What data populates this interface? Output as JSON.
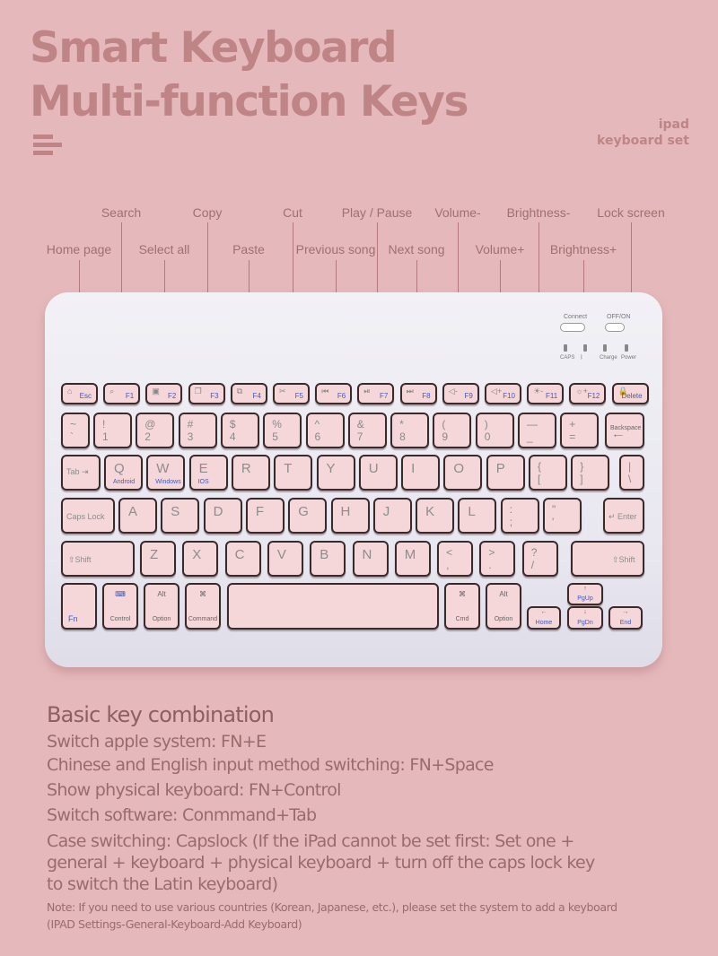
{
  "header": {
    "title_line1": "Smart Keyboard",
    "title_line2": "Multi-function Keys",
    "subtitle_line1": "ipad",
    "subtitle_line2": "keyboard set"
  },
  "callouts": {
    "row1": [
      "Search",
      "Copy",
      "Cut",
      "Play / Pause",
      "Volume-",
      "Brightness-",
      "Lock screen"
    ],
    "row2": [
      "Home page",
      "Select all",
      "Paste",
      "Previous song",
      "Next song",
      "Volume+",
      "Brightness+"
    ]
  },
  "keyboard": {
    "switches": {
      "connect": "Connect",
      "power": "OFF/ON"
    },
    "indicators": [
      "CAPS",
      "ᛒ",
      "Charge",
      "Power"
    ],
    "fn_row": [
      {
        "icon": "⌂",
        "label": "Esc"
      },
      {
        "icon": "⌕",
        "label": "F1"
      },
      {
        "icon": "▣",
        "label": "F2"
      },
      {
        "icon": "❐",
        "label": "F3"
      },
      {
        "icon": "⧉",
        "label": "F4"
      },
      {
        "icon": "✂",
        "label": "F5"
      },
      {
        "icon": "⏮",
        "label": "F6"
      },
      {
        "icon": "⏯",
        "label": "F7"
      },
      {
        "icon": "⏭",
        "label": "F8"
      },
      {
        "icon": "◁-",
        "label": "F9"
      },
      {
        "icon": "◁+",
        "label": "F10"
      },
      {
        "icon": "☀-",
        "label": "F11"
      },
      {
        "icon": "☼+",
        "label": "F12"
      },
      {
        "icon": "🔒",
        "label": "Delete"
      }
    ],
    "number_row": [
      {
        "top": "~",
        "bot": "`"
      },
      {
        "top": "!",
        "bot": "1"
      },
      {
        "top": "@",
        "bot": "2"
      },
      {
        "top": "#",
        "bot": "3"
      },
      {
        "top": "$",
        "bot": "4"
      },
      {
        "top": "%",
        "bot": "5"
      },
      {
        "top": "^",
        "bot": "6"
      },
      {
        "top": "&",
        "bot": "7"
      },
      {
        "top": "*",
        "bot": "8"
      },
      {
        "top": "(",
        "bot": "9"
      },
      {
        "top": ")",
        "bot": "0"
      },
      {
        "top": "—",
        "bot": "_"
      },
      {
        "top": "+",
        "bot": "="
      },
      {
        "top": "Backspace",
        "bot": "⟵"
      }
    ],
    "qwerty_row": [
      {
        "main": "Tab ⇥"
      },
      {
        "main": "Q",
        "sub": "Android"
      },
      {
        "main": "W",
        "sub": "Windows"
      },
      {
        "main": "E",
        "sub": "IOS"
      },
      {
        "main": "R"
      },
      {
        "main": "T"
      },
      {
        "main": "Y"
      },
      {
        "main": "U"
      },
      {
        "main": "I"
      },
      {
        "main": "O"
      },
      {
        "main": "P"
      },
      {
        "top": "{",
        "bot": "["
      },
      {
        "top": "}",
        "bot": "]"
      },
      {
        "top": "|",
        "bot": "\\"
      }
    ],
    "home_row": [
      {
        "main": "Caps Lock"
      },
      {
        "main": "A"
      },
      {
        "main": "S"
      },
      {
        "main": "D"
      },
      {
        "main": "F"
      },
      {
        "main": "G"
      },
      {
        "main": "H"
      },
      {
        "main": "J"
      },
      {
        "main": "K"
      },
      {
        "main": "L"
      },
      {
        "top": ":",
        "bot": ";"
      },
      {
        "top": "\"",
        "bot": "'"
      },
      {
        "main": "↵ Enter"
      }
    ],
    "shift_row": [
      {
        "main": "⇧Shift"
      },
      {
        "main": "Z"
      },
      {
        "main": "X"
      },
      {
        "main": "C"
      },
      {
        "main": "V"
      },
      {
        "main": "B"
      },
      {
        "main": "N"
      },
      {
        "main": "M"
      },
      {
        "top": "<",
        "bot": ","
      },
      {
        "top": ">",
        "bot": "."
      },
      {
        "top": "?",
        "bot": "/"
      },
      {
        "main": "⇧Shift"
      }
    ],
    "bottom_row": [
      {
        "label": "Fn"
      },
      {
        "icon": "⌨",
        "label": "Control"
      },
      {
        "icon": "Alt",
        "label": "Option"
      },
      {
        "icon": "⌘",
        "label": "Command"
      },
      {
        "label": ""
      },
      {
        "icon": "⌘",
        "label": "Cmd"
      },
      {
        "icon": "Alt",
        "label": "Option"
      },
      {
        "icon": "←",
        "label": "Home"
      },
      {
        "icon": "↑",
        "label": "PgUp"
      },
      {
        "icon": "↓",
        "label": "PgDn"
      },
      {
        "icon": "→",
        "label": "End"
      }
    ]
  },
  "combinations": {
    "heading": "Basic key combination",
    "lines": [
      "Switch apple system: FN+E",
      "Chinese and English input method switching: FN+Space",
      "Show physical keyboard: FN+Control",
      "Switch software: Conmmand+Tab",
      "Case switching: Capslock (If the iPad cannot be set first: Set one +",
      "general + keyboard + physical keyboard + turn off the caps lock key",
      "to switch the Latin keyboard)"
    ],
    "note": "Note: If you need to use various countries (Korean, Japanese, etc.), please set the system to add a keyboard (IPAD Settings-General-Keyboard-Add Keyboard)"
  }
}
